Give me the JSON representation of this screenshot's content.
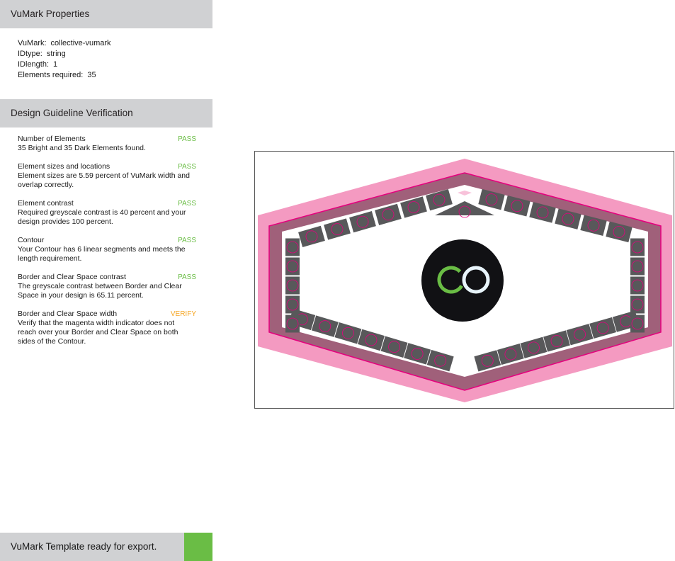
{
  "properties": {
    "header": "VuMark Properties",
    "rows": [
      {
        "key": "VuMark:",
        "value": "collective-vumark"
      },
      {
        "key": "IDtype:",
        "value": "string"
      },
      {
        "key": "IDlength:",
        "value": "1"
      },
      {
        "key": "Elements required:",
        "value": "35"
      }
    ]
  },
  "verification": {
    "header": "Design Guideline Verification",
    "checks": [
      {
        "title": "Number of Elements",
        "status": "PASS",
        "desc": "35 Bright and 35 Dark Elements found."
      },
      {
        "title": "Element sizes and locations",
        "status": "PASS",
        "desc": "Element sizes are 5.59 percent of VuMark width and overlap correctly."
      },
      {
        "title": "Element contrast",
        "status": "PASS",
        "desc": "Required greyscale contrast is 40 percent and your design provides 100 percent."
      },
      {
        "title": "Contour",
        "status": "PASS",
        "desc": "Your Contour has 6 linear segments and meets the length requirement."
      },
      {
        "title": "Border and Clear Space contrast",
        "status": "PASS",
        "desc": "The greyscale contrast between Border and Clear Space in your design is 65.11 percent."
      },
      {
        "title": "Border and Clear Space width",
        "status": "VERIFY",
        "desc": "Verify that the magenta width indicator does not reach over your Border and Clear Space on both sides of the Contour."
      }
    ]
  },
  "footer": {
    "message": "VuMark Template ready for export.",
    "status_color": "#6abd45"
  },
  "preview": {
    "logo_text": "CO",
    "colors": {
      "outer_band": "#f49ac1",
      "border": "#a0607a",
      "magenta_line": "#e6007e",
      "element_dark": "#58585a",
      "logo_bg": "#111114",
      "logo_green": "#6abd45",
      "logo_white": "#e8f4fb"
    }
  }
}
